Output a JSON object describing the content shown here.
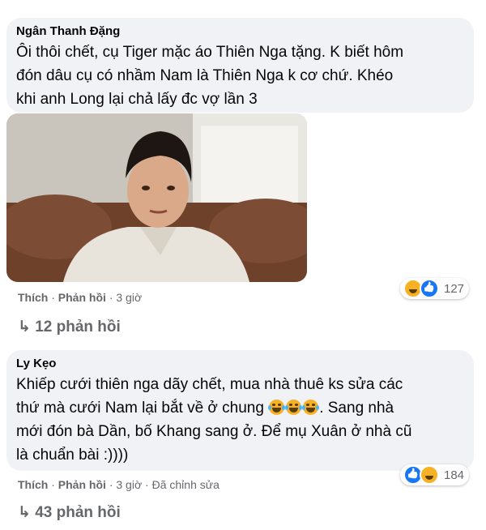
{
  "comments": [
    {
      "author": "Ngân Thanh Đặng",
      "lines": [
        "Ôi thôi chết, cụ Tiger mặc áo Thiên Nga tặng. K biết hôm",
        "đón dâu cụ có nhầm Nam là Thiên Nga k cơ chứ. Khéo",
        "khi anh Long lại chả lấy đc vợ lần 3"
      ],
      "like_label": "Thích",
      "reply_label": "Phản hồi",
      "time": "3 giờ",
      "reaction_count": "127",
      "replies_label": "12 phản hồi",
      "reactions": [
        "haha",
        "like"
      ]
    },
    {
      "author": "Ly Kẹo",
      "line1": "Khiếp cưới thiên nga dãy chết, mua nhà thuê ks sửa các",
      "line2_before": "thứ mà cưới Nam lại bắt về ở chung",
      "line2_after": ". Sang nhà",
      "line3": "mới đón bà Dần, bố Khang sang ở. Để mụ Xuân ở nhà cũ",
      "line4": "là chuẩn bài :))))",
      "like_label": "Thích",
      "reply_label": "Phản hồi",
      "time": "3 giờ",
      "edited": "Đã chỉnh sửa",
      "reaction_count": "184",
      "replies_label": "43 phản hồi",
      "reactions": [
        "like",
        "haha"
      ],
      "emoji_count": 3
    }
  ]
}
